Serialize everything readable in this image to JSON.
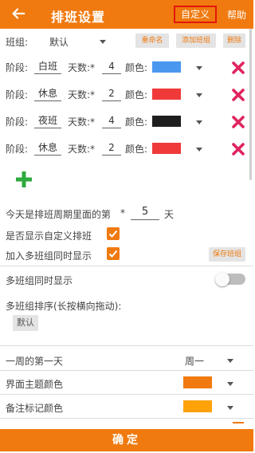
{
  "header": {
    "title": "排班设置",
    "custom_label": "自定义",
    "help_label": "帮助"
  },
  "group": {
    "label": "班组:",
    "value": "默认",
    "rename_label": "重命名",
    "add_label": "添加班组",
    "delete_label": "删除"
  },
  "stages": [
    {
      "stage_label": "阶段:",
      "name": "白班",
      "days_label": "天数:*",
      "days": "4",
      "color_label": "颜色:",
      "color": "#4A97F0"
    },
    {
      "stage_label": "阶段:",
      "name": "休息",
      "days_label": "天数:*",
      "days": "2",
      "color_label": "颜色:",
      "color": "#F03A3A"
    },
    {
      "stage_label": "阶段:",
      "name": "夜班",
      "days_label": "天数:*",
      "days": "4",
      "color_label": "颜色:",
      "color": "#1E1E1E"
    },
    {
      "stage_label": "阶段:",
      "name": "休息",
      "days_label": "天数:*",
      "days": "2",
      "color_label": "颜色:",
      "color": "#F03A3A"
    }
  ],
  "cycle_day": {
    "prefix": "今天是排班周期里面的第",
    "star": "*",
    "value": "5",
    "suffix": "天"
  },
  "options": {
    "show_custom_label": "是否显示自定义排班",
    "show_custom_checked": true,
    "join_multi_label": "加入多班组同时显示",
    "join_multi_checked": true,
    "save_group_label": "保存班组"
  },
  "multi": {
    "show_label": "多班组同时显示",
    "show_enabled": false,
    "sort_label": "多班组排序(长按横向拖动):",
    "chip_label": "默认"
  },
  "settings": {
    "week_start_label": "一周的第一天",
    "week_start_value": "周一",
    "theme_color_label": "界面主题颜色",
    "theme_color": "#F07A0F",
    "note_color_label": "备注标记颜色",
    "note_color": "#FFA20A"
  },
  "confirm_label": "确定",
  "colors": {
    "accent": "#F07A0F",
    "delete_x": "#E0245E",
    "add_plus": "#2EAA3E"
  },
  "icons": {
    "back": "arrow-left-icon",
    "delete": "close-x-icon",
    "add": "plus-icon",
    "dropdown": "caret-down-icon",
    "check": "checkmark-icon"
  }
}
